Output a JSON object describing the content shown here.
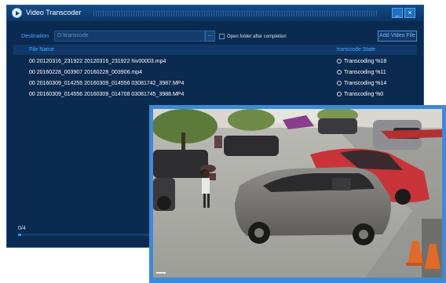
{
  "window": {
    "title": "Video Transcoder",
    "minimize_label": "_",
    "close_label": "×"
  },
  "toolbar": {
    "destination_label": "Destination",
    "destination_value": "D:\\transcode",
    "browse_label": "...",
    "open_folder_label": "Open folder after completion",
    "add_video_label": "Add Video File"
  },
  "list": {
    "col_name": "File Name",
    "col_state": "transcode State",
    "rows": [
      {
        "name": "00 20120316_231922 20120316_231922 hiv00003.mp4",
        "status": "Transcoding %18"
      },
      {
        "name": "00 20160228_003907 20160228_003906.mp4",
        "status": "Transcoding %11"
      },
      {
        "name": "00 20160309_014255 20160309_014556 03081742_3987.MP4",
        "status": "Transcoding %14"
      },
      {
        "name": "00 20160309_014556 20160309_014708 03081745_3988.MP4",
        "status": "Transcoding %0"
      }
    ]
  },
  "progress": {
    "label": "0/4",
    "fraction": 0.0
  },
  "colors": {
    "window_bg": "#0b2a4f",
    "accent": "#4da3ff",
    "overlay_border": "#3d8ad6"
  },
  "icons": {
    "app": "video-transcoder-icon",
    "status": "spinner-icon",
    "minimize": "minimize-icon",
    "close": "close-icon"
  }
}
